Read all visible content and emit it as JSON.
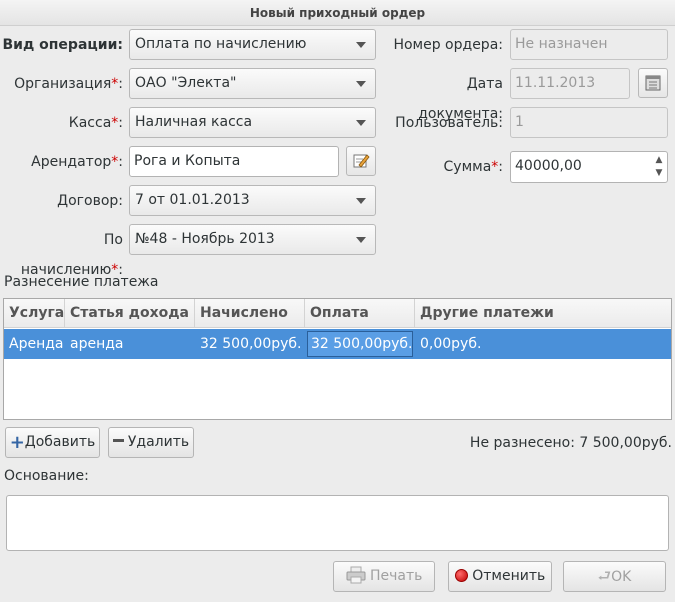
{
  "window": {
    "title": "Новый приходный ордер"
  },
  "form": {
    "operation_label": "Вид операции:",
    "operation_value": "Оплата по начислению",
    "organization_label": "Организация",
    "organization_value": "ОАО \"Электа\"",
    "kassa_label": "Касса",
    "kassa_value": "Наличная касса",
    "tenant_label": "Арендатор",
    "tenant_value": "Рога и Копыта",
    "contract_label": "Договор:",
    "contract_value": "7 от 01.01.2013",
    "accrual_label": "По начислению",
    "accrual_value": "№48 - Ноябрь 2013",
    "required_mark": "*",
    "order_number_label": "Номер ордера:",
    "order_number_placeholder": "Не назначен",
    "doc_date_label": "Дата документа:",
    "doc_date_value": "11.11.2013",
    "user_label": "Пользователь:",
    "user_value": "1",
    "sum_label": "Сумма",
    "sum_value": "40000,00"
  },
  "distribution": {
    "title": "Разнесение платежа",
    "columns": [
      "Услуга",
      "Статья дохода",
      "Начислено",
      "Оплата",
      "Другие платежи"
    ],
    "rows": [
      [
        "Аренда",
        "аренда",
        "32 500,00руб.",
        "32 500,00руб.",
        "0,00руб."
      ]
    ],
    "add_label": "Добавить",
    "remove_label": "Удалить",
    "undistributed": "Не разнесено: 7 500,00руб."
  },
  "basis": {
    "label": "Основание:"
  },
  "footer": {
    "print_label": "Печать",
    "cancel_label": "Отменить",
    "ok_label": "OK"
  },
  "colors": {
    "selection": "#4a90d9",
    "required": "#cc0000"
  }
}
